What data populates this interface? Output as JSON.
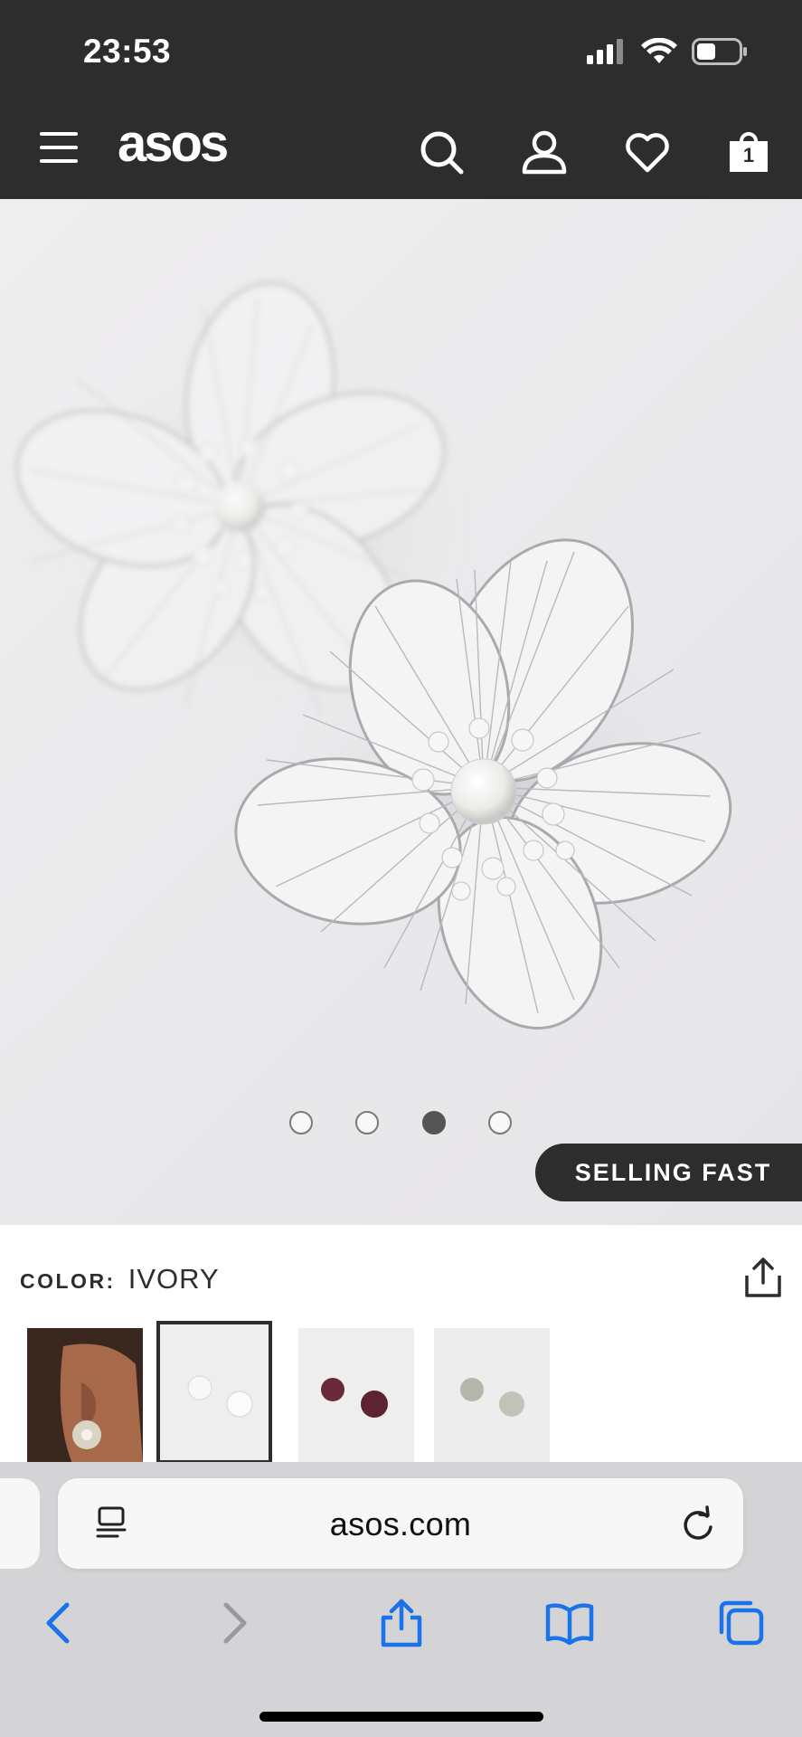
{
  "status_bar": {
    "time": "23:53",
    "icons": [
      "cellular-signal-icon",
      "wifi-icon",
      "battery-icon"
    ]
  },
  "header": {
    "logo": "asos",
    "icons": [
      "menu-icon",
      "search-icon",
      "account-icon",
      "wishlist-heart-icon",
      "bag-icon"
    ],
    "bag_count": "1"
  },
  "product": {
    "image_description": "silver flower earrings with pearl centres",
    "carousel": {
      "total": 4,
      "active_index": 3
    },
    "badge": "SELLING FAST",
    "color_label": "COLOR:",
    "color_value": "IVORY",
    "thumbnails": [
      {
        "name": "model-wearing",
        "selected": false
      },
      {
        "name": "ivory",
        "selected": true
      },
      {
        "name": "burgundy",
        "selected": false
      },
      {
        "name": "sage",
        "selected": false
      }
    ]
  },
  "safari": {
    "url": "asos.com",
    "toolbar": [
      "back-icon",
      "forward-icon",
      "share-icon",
      "bookmarks-icon",
      "tabs-icon"
    ]
  },
  "colors": {
    "header_bg": "#2d2d2d",
    "safari_blue": "#1a73e8",
    "safari_bg": "#d4d4d6"
  }
}
